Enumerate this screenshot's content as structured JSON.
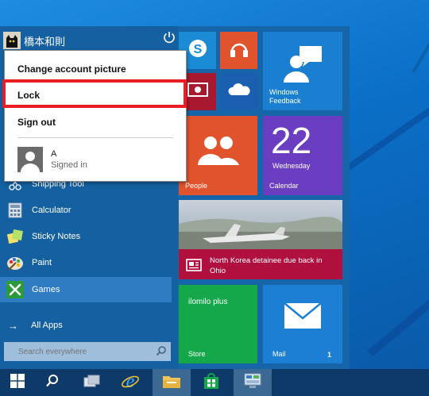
{
  "user": {
    "name": "橋本和則"
  },
  "flyout": {
    "items": [
      {
        "label": "Change account picture"
      },
      {
        "label": "Lock"
      },
      {
        "label": "Sign out"
      }
    ],
    "other_user": {
      "name": "A",
      "status": "Signed in"
    }
  },
  "apps": [
    {
      "label": "Shipping Tool",
      "icon": "scissors-icon"
    },
    {
      "label": "Calculator",
      "icon": "calculator-icon"
    },
    {
      "label": "Sticky Notes",
      "icon": "sticky-notes-icon"
    },
    {
      "label": "Paint",
      "icon": "paint-palette-icon"
    },
    {
      "label": "Games",
      "icon": "xbox-games-icon"
    }
  ],
  "all_apps": {
    "label": "All Apps"
  },
  "search": {
    "placeholder": "Search everywhere"
  },
  "tiles": {
    "windows_feedback": {
      "label": "Windows Feedback"
    },
    "people": {
      "label": "People"
    },
    "calendar": {
      "day": "22",
      "weekday": "Wednesday",
      "label": "Calendar"
    },
    "news": {
      "headline": "North Korea detainee due back in Ohio"
    },
    "store_app": {
      "title": "ilomilo plus",
      "label": "Store"
    },
    "mail": {
      "label": "Mail",
      "count": "1"
    }
  },
  "colors": {
    "start_bg": "#1565a8",
    "skype": "#1a8bd4",
    "music": "#e0532c",
    "video": "#a8182f",
    "onedrive": "#1a5fb0",
    "feedback": "#1b7fd1",
    "people": "#e0532c",
    "calendar": "#6b3ec1",
    "news": "#b0103e",
    "store": "#14a84a",
    "mail": "#1c7fd4",
    "lock_highlight": "#ea1d25"
  }
}
